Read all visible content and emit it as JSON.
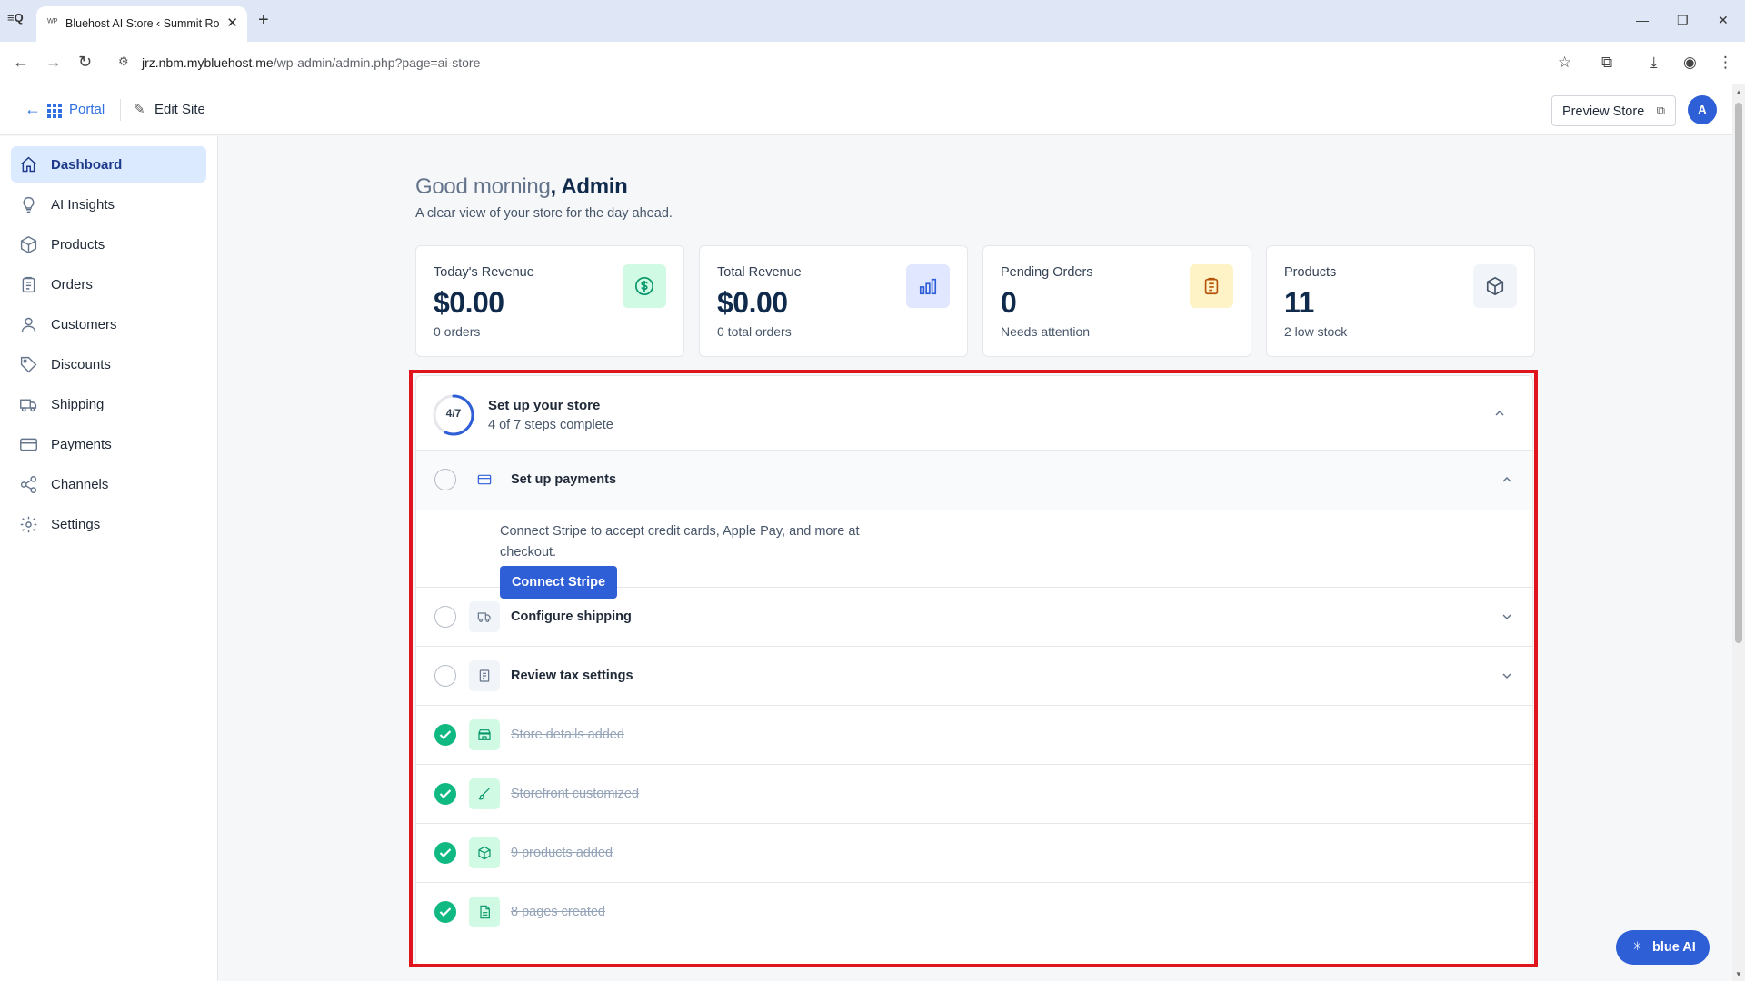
{
  "browser": {
    "tab_title": "Bluehost AI Store ‹ Summit Road",
    "url_host": "jrz.nbm.mybluehost.me",
    "url_path": "/wp-admin/admin.php?page=ai-store"
  },
  "header": {
    "portal_label": "Portal",
    "edit_site_label": "Edit Site",
    "preview_label": "Preview Store",
    "avatar_initial": "A"
  },
  "sidebar": {
    "items": [
      {
        "label": "Dashboard"
      },
      {
        "label": "AI Insights"
      },
      {
        "label": "Products"
      },
      {
        "label": "Orders"
      },
      {
        "label": "Customers"
      },
      {
        "label": "Discounts"
      },
      {
        "label": "Shipping"
      },
      {
        "label": "Payments"
      },
      {
        "label": "Channels"
      },
      {
        "label": "Settings"
      }
    ]
  },
  "main": {
    "greeting": "Good morning",
    "greeting_name": ", Admin",
    "subtitle": "A clear view of your store for the day ahead.",
    "cards": [
      {
        "label": "Today's Revenue",
        "value": "$0.00",
        "sub": "0 orders"
      },
      {
        "label": "Total Revenue",
        "value": "$0.00",
        "sub": "0 total orders"
      },
      {
        "label": "Pending Orders",
        "value": "0",
        "sub": "Needs attention"
      },
      {
        "label": "Products",
        "value": "11",
        "sub": "2 low stock"
      }
    ]
  },
  "setup": {
    "progress": "4/7",
    "progress_fraction": 0.5714,
    "title": "Set up your store",
    "subtitle": "4 of 7 steps complete",
    "steps": [
      {
        "label": "Set up payments",
        "done": false
      },
      {
        "label": "Configure shipping",
        "done": false
      },
      {
        "label": "Review tax settings",
        "done": false
      },
      {
        "label": "Store details added",
        "done": true
      },
      {
        "label": "Storefront customized",
        "done": true
      },
      {
        "label": "9 products added",
        "done": true
      },
      {
        "label": "8 pages created",
        "done": true
      }
    ],
    "payments_desc": "Connect Stripe to accept credit cards, Apple Pay, and more at checkout.",
    "connect_label": "Connect Stripe"
  },
  "assistant": {
    "label": "blue AI"
  },
  "colors": {
    "accent": "#2f5fd7",
    "success": "#10b981",
    "highlight": "#e0141c"
  }
}
